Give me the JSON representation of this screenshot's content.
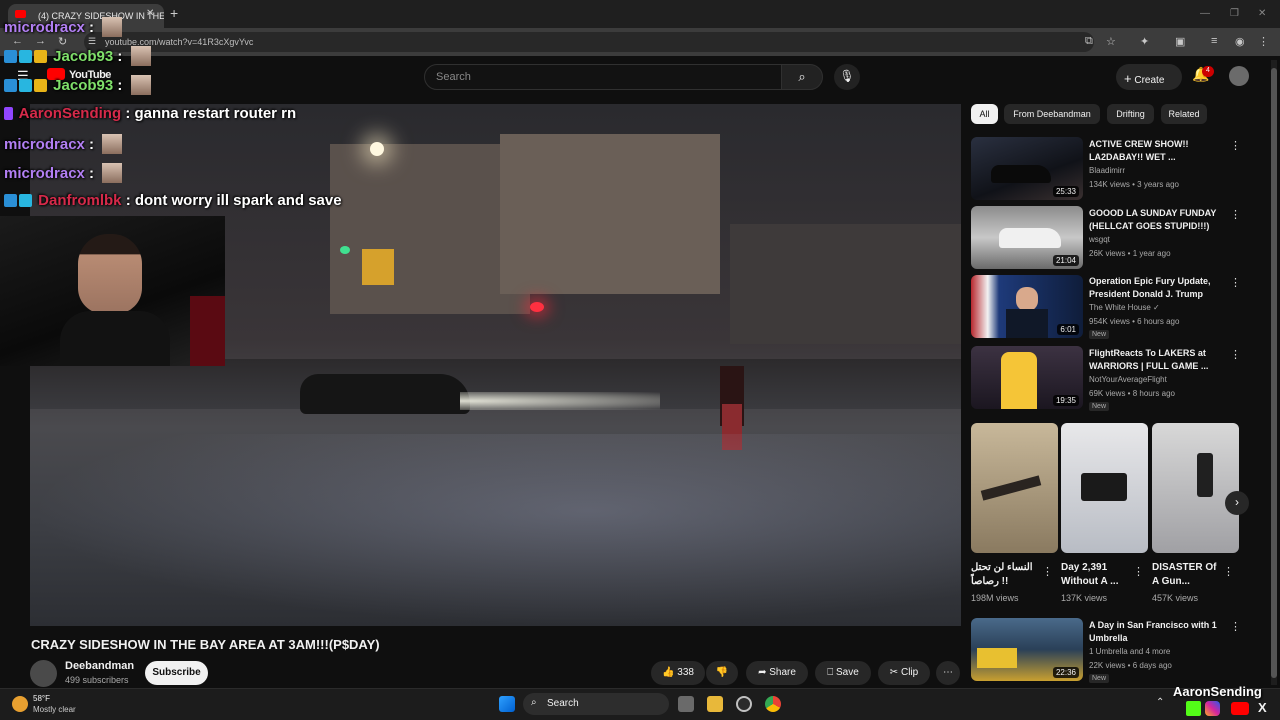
{
  "browser": {
    "tab_title": "(4) CRAZY SIDESHOW IN THE B",
    "url": "youtube.com/watch?v=41R3cXgvYvc"
  },
  "youtube": {
    "logo_text": "YouTube",
    "search_placeholder": "Search",
    "create_label": "Create",
    "notification_count": "4"
  },
  "chat": [
    {
      "user": "microdracx",
      "message": ":",
      "color": "purple"
    },
    {
      "user": "Jacob93",
      "message": ":",
      "color": "green"
    },
    {
      "user": "Jacob93",
      "message": ":",
      "color": "green"
    },
    {
      "user": "AaronSending",
      "message": ": ganna restart router rn",
      "color": "red"
    },
    {
      "user": "microdracx",
      "message": ":",
      "color": "purple"
    },
    {
      "user": "microdracx",
      "message": ":",
      "color": "purple"
    },
    {
      "user": "Danfromlbk",
      "message": ": dont worry ill spark and save",
      "color": "red"
    }
  ],
  "video": {
    "title": "CRAZY SIDESHOW IN THE BAY AREA AT 3AM!!!(P$DAY)",
    "channel": "Deebandman",
    "subscribers": "499 subscribers",
    "subscribe_label": "Subscribe",
    "likes": "338",
    "share_label": "Share",
    "save_label": "Save",
    "clip_label": "Clip"
  },
  "chips": [
    "All",
    "From Deebandman",
    "Drifting",
    "Related"
  ],
  "related": [
    {
      "title": "ACTIVE CREW SHOW!! LA2DABAY!! WET ...",
      "channel": "Blaadimirr",
      "meta": "134K views • 3 years ago",
      "duration": "25:33",
      "new": ""
    },
    {
      "title": "GOOOD LA SUNDAY FUNDAY (HELLCAT GOES STUPID!!!)",
      "channel": "wsgqt",
      "meta": "26K views • 1 year ago",
      "duration": "21:04",
      "new": ""
    },
    {
      "title": "Operation Epic Fury Update, President Donald J. Trump",
      "channel": "The White House ✓",
      "meta": "954K views • 6 hours ago",
      "duration": "6:01",
      "new": "New"
    },
    {
      "title": "FlightReacts To LAKERS at WARRIORS | FULL GAME ...",
      "channel": "NotYourAverageFlight",
      "meta": "69K views • 8 hours ago",
      "duration": "19:35",
      "new": "New"
    }
  ],
  "shorts": [
    {
      "title": "النساء لن تحتل رصاصاً !!",
      "views": "198M views"
    },
    {
      "title": "Day 2,391 Without A ...",
      "views": "137K views"
    },
    {
      "title": "DISASTER Of A Gun...",
      "views": "457K views"
    }
  ],
  "related_bottom": {
    "title": "A Day in San Francisco with 1 Umbrella",
    "channel": "1 Umbrella and 4 more",
    "meta": "22K views • 6 days ago",
    "duration": "22:36",
    "new": "New"
  },
  "taskbar": {
    "weather_temp": "58°F",
    "weather_desc": "Mostly clear",
    "search_label": "Search",
    "streamer_name": "AaronSending"
  }
}
